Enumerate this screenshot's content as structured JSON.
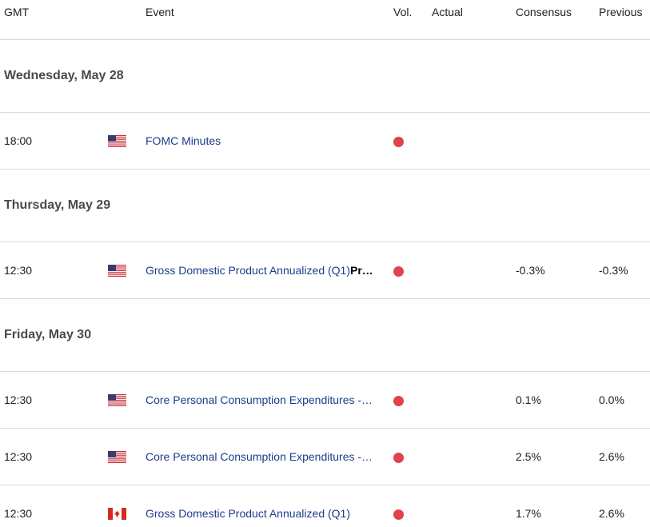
{
  "header": {
    "gmt": "GMT",
    "event": "Event",
    "vol": "Vol.",
    "actual": "Actual",
    "consensus": "Consensus",
    "previous": "Previous"
  },
  "colors": {
    "event_link": "#1c3c8c",
    "high_volatility": "#e0434e"
  },
  "days": [
    {
      "label": "Wednesday, May 28",
      "events": [
        {
          "time": "18:00",
          "country": "us-flag-icon",
          "event": "FOMC Minutes",
          "event_tail": "",
          "volatility": "high",
          "actual": "",
          "consensus": "",
          "previous": ""
        }
      ]
    },
    {
      "label": "Thursday, May 29",
      "events": [
        {
          "time": "12:30",
          "country": "us-flag-icon",
          "event": "Gross Domestic Product Annualized (Q1)",
          "event_tail": "Pr…",
          "volatility": "high",
          "actual": "",
          "consensus": "-0.3%",
          "previous": "-0.3%"
        }
      ]
    },
    {
      "label": "Friday, May 30",
      "events": [
        {
          "time": "12:30",
          "country": "us-flag-icon",
          "event": "Core Personal Consumption Expenditures -…",
          "event_tail": "",
          "volatility": "high",
          "actual": "",
          "consensus": "0.1%",
          "previous": "0.0%"
        },
        {
          "time": "12:30",
          "country": "us-flag-icon",
          "event": "Core Personal Consumption Expenditures -…",
          "event_tail": "",
          "volatility": "high",
          "actual": "",
          "consensus": "2.5%",
          "previous": "2.6%"
        },
        {
          "time": "12:30",
          "country": "canada-flag-icon",
          "event": "Gross Domestic Product Annualized (Q1)",
          "event_tail": "",
          "volatility": "high",
          "actual": "",
          "consensus": "1.7%",
          "previous": "2.6%"
        }
      ]
    }
  ]
}
